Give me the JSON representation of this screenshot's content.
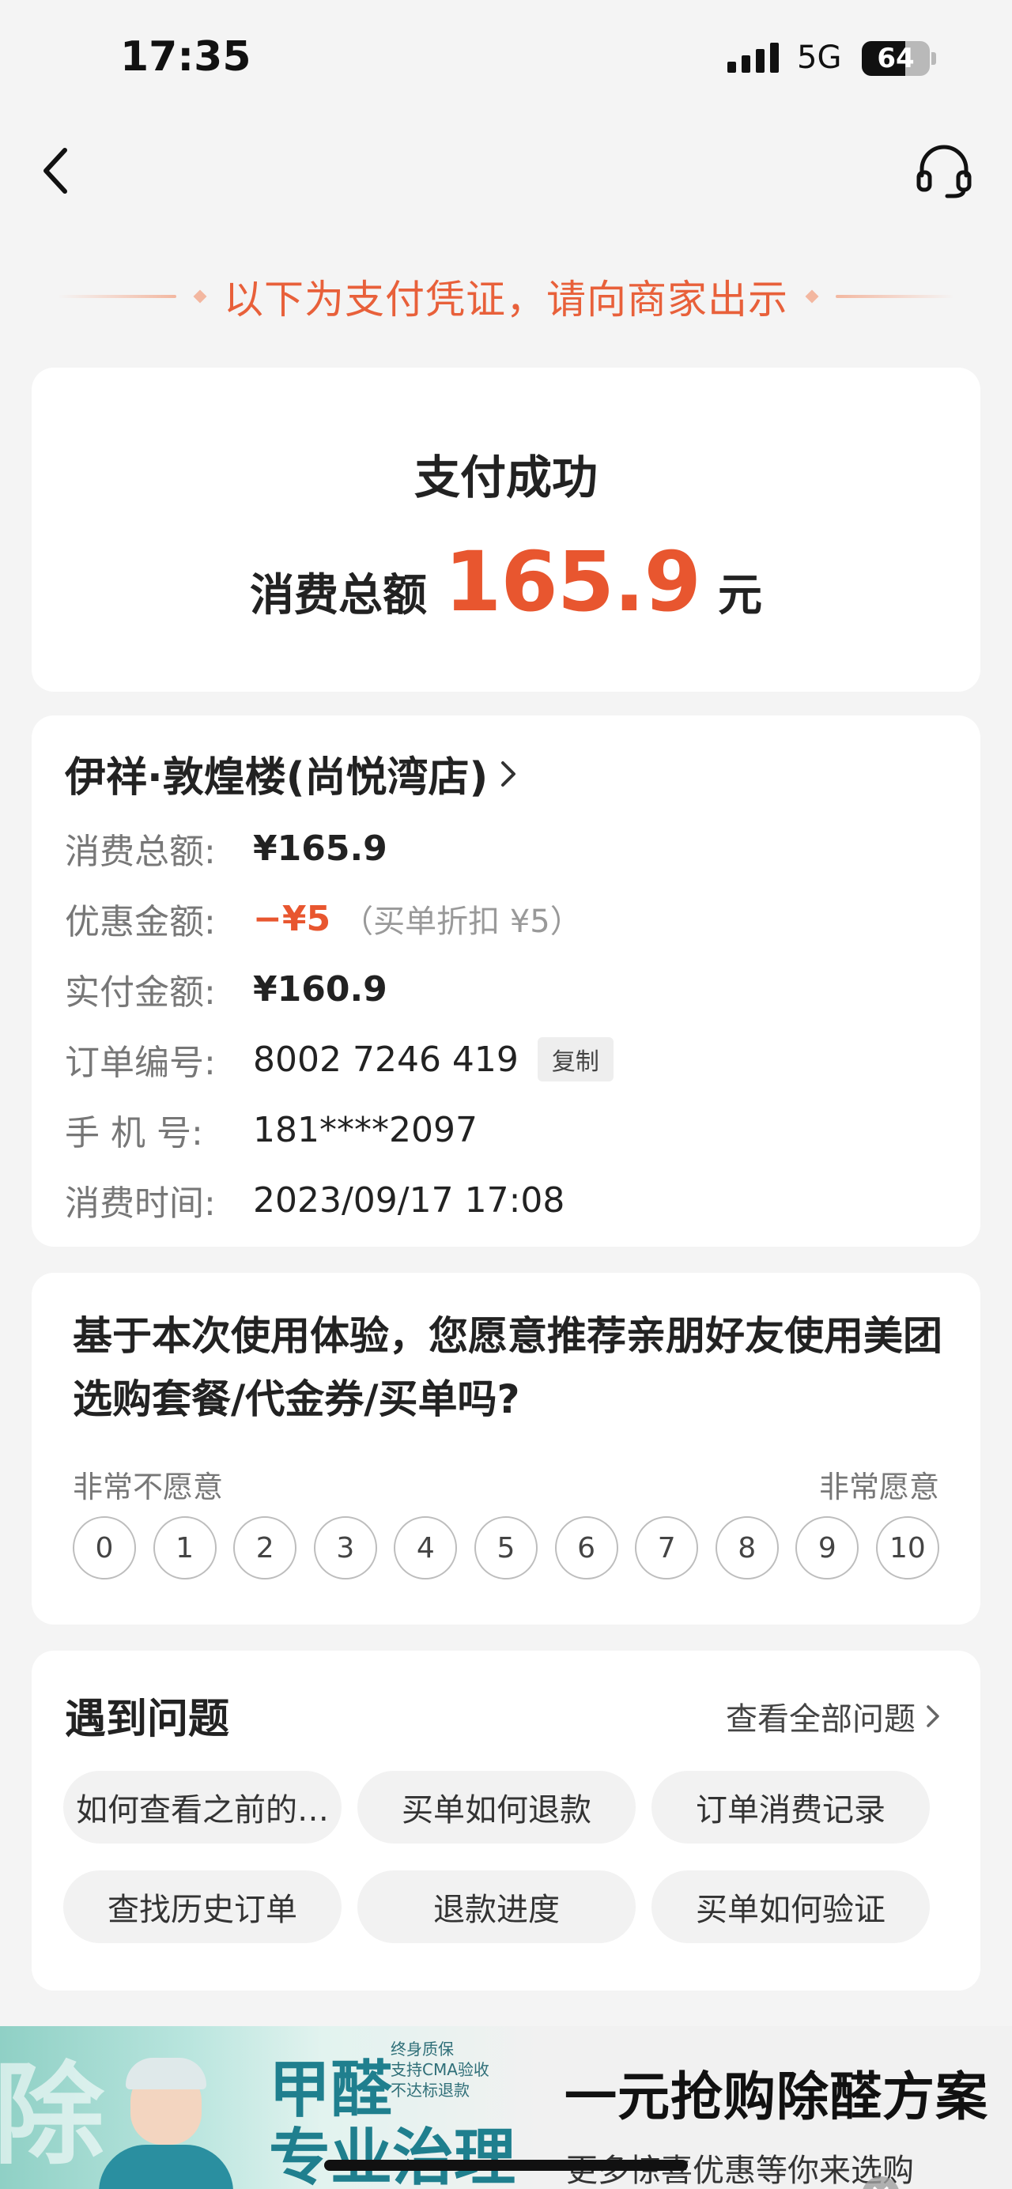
{
  "status": {
    "time": "17:35",
    "network": "5G",
    "battery": "64"
  },
  "banner": {
    "text": "以下为支付凭证，请向商家出示"
  },
  "payment": {
    "title": "支付成功",
    "amount_label": "消费总额",
    "amount": "165.9",
    "unit": "元"
  },
  "order": {
    "shop_name": "伊祥·敦煌楼(尚悦湾店)",
    "rows": [
      {
        "label": "消费总额:",
        "value": "¥165.9"
      },
      {
        "label": "优惠金额:",
        "value": "−¥5",
        "note": "（买单折扣 ¥5）"
      },
      {
        "label": "实付金额:",
        "value": "¥160.9"
      },
      {
        "label": "订单编号:",
        "value": "8002 7246 419",
        "action": "复制"
      },
      {
        "label": "手  机  号:",
        "value": "181****2097"
      },
      {
        "label": "消费时间:",
        "value": "2023/09/17 17:08"
      }
    ]
  },
  "nps": {
    "question": "基于本次使用体验，您愿意推荐亲朋好友使用美团选购套餐/代金券/买单吗?",
    "low_label": "非常不愿意",
    "high_label": "非常愿意",
    "options": [
      "0",
      "1",
      "2",
      "3",
      "4",
      "5",
      "6",
      "7",
      "8",
      "9",
      "10"
    ]
  },
  "faq": {
    "title": "遇到问题",
    "view_all": "查看全部问题",
    "items": [
      "如何查看之前的…",
      "买单如何退款",
      "订单消费记录",
      "查找历史订单",
      "退款进度",
      "买单如何验证"
    ]
  },
  "ad": {
    "big_char": "除",
    "main_line1": "甲醛",
    "main_line2": "专业治理",
    "small_lines": "终身质保\n支持CMA验收\n不达标退款",
    "headline": "一元抢购除醛方案",
    "subline": "更多惊喜优惠等你来选购"
  },
  "colors": {
    "accent": "#e8562f",
    "banner": "#e8603a",
    "ad_teal": "#1f7f8e"
  },
  "icons": {
    "back": "chevron-left-icon",
    "support": "headset-icon",
    "close": "close-icon"
  }
}
